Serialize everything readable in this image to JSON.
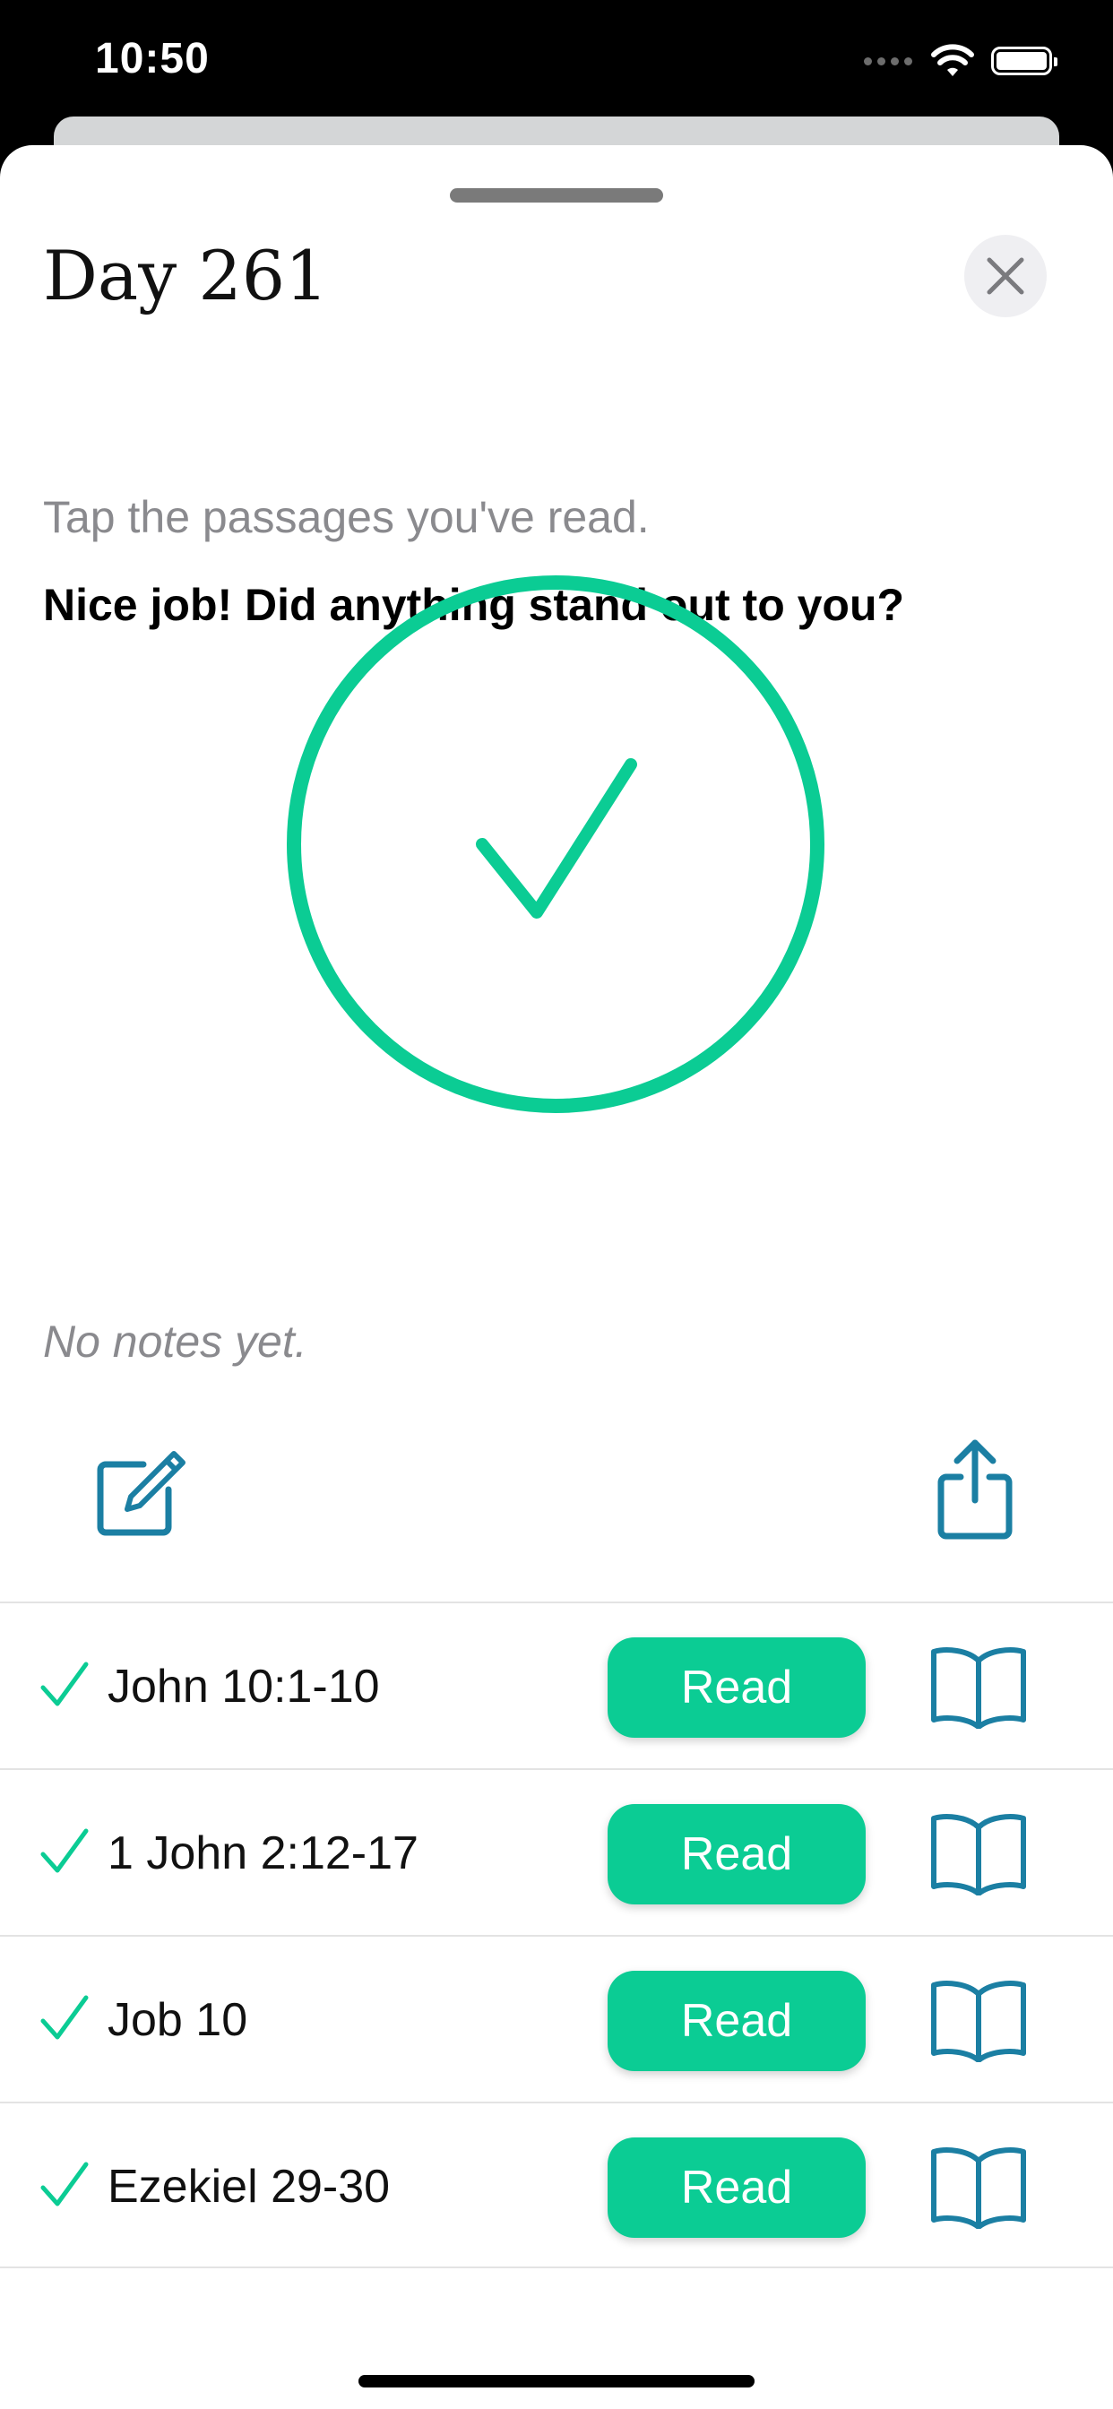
{
  "status_bar": {
    "time": "10:50",
    "icons": [
      "signal-icon",
      "wifi-icon",
      "battery-icon"
    ]
  },
  "sheet": {
    "title": "Day 261",
    "subtitle": "Tap the passages you've read.",
    "prompt": "Nice job! Did anything stand out to you?",
    "completion_icon": "check-circle-icon",
    "notes_empty": "No notes yet.",
    "actions": {
      "edit_icon": "edit-note-icon",
      "share_icon": "share-icon"
    }
  },
  "passages": [
    {
      "ref": "John 10:1-10",
      "read_label": "Read",
      "checked": true
    },
    {
      "ref": "1 John 2:12-17",
      "read_label": "Read",
      "checked": true
    },
    {
      "ref": "Job 10",
      "read_label": "Read",
      "checked": true
    },
    {
      "ref": "Ezekiel 29-30",
      "read_label": "Read",
      "checked": true
    }
  ],
  "colors": {
    "accent_green": "#0bcc94",
    "icon_teal": "#1b7fa3",
    "muted_text": "#8a8a8e"
  }
}
